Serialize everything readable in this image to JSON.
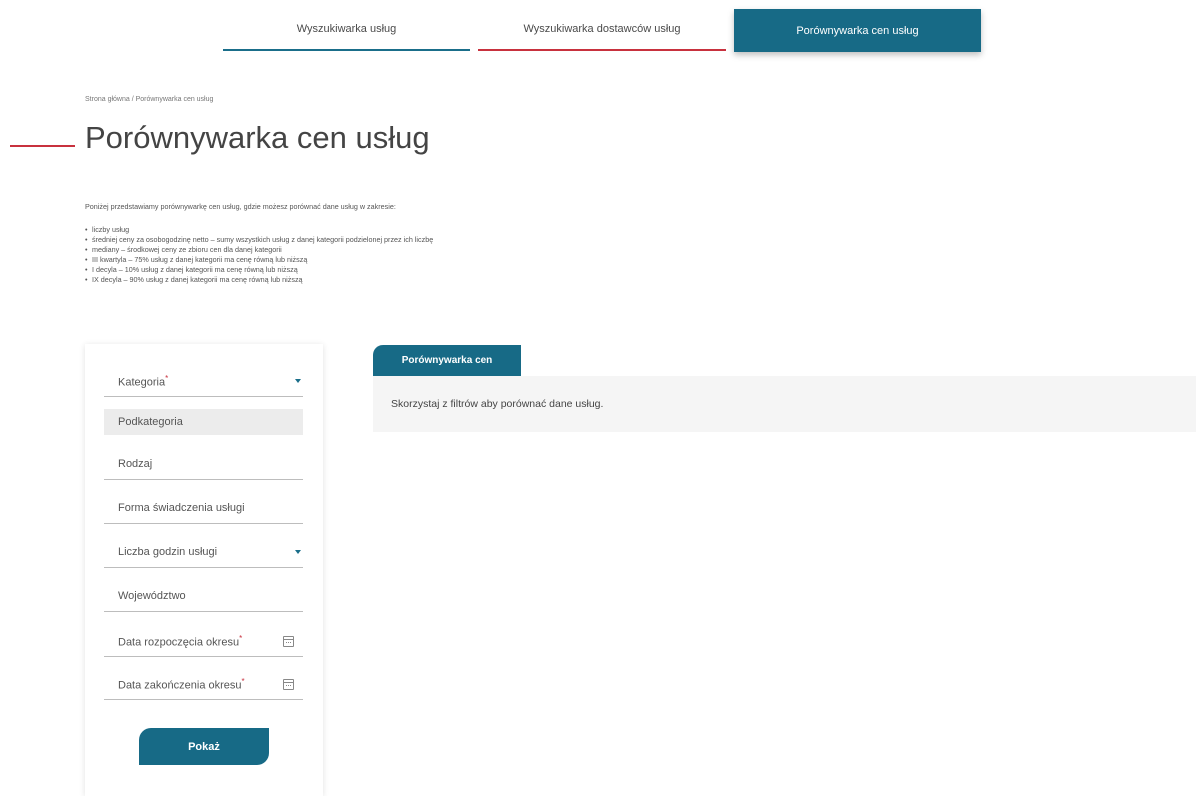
{
  "nav": {
    "tabs": [
      {
        "label": "Wyszukiwarka usług"
      },
      {
        "label": "Wyszukiwarka dostawców usług"
      },
      {
        "label": "Porównywarka cen usług"
      }
    ]
  },
  "breadcrumb": "Strona główna / Porównywarka cen usług",
  "title": "Porównywarka cen usług",
  "intro": {
    "lead": "Poniżej przedstawiamy porównywarkę cen usług, gdzie możesz porównać dane usług w zakresie:",
    "items": [
      "liczby usług",
      "średniej ceny za osobogodzinę netto – sumy wszystkich usług z danej kategorii podzielonej przez ich liczbę",
      "mediany – środkowej ceny ze zbioru cen dla danej kategorii",
      "III kwartyla – 75% usług z danej kategorii ma cenę równą lub niższą",
      "I decyla – 10% usług z danej kategorii ma cenę równą lub niższą",
      "IX decyla – 90% usług z danej kategorii ma cenę równą lub niższą"
    ]
  },
  "filters": {
    "category": {
      "label": "Kategoria",
      "required": "*"
    },
    "subcategory": {
      "label": "Podkategoria"
    },
    "type": {
      "label": "Rodzaj"
    },
    "form": {
      "label": "Forma świadczenia usługi"
    },
    "hours": {
      "label": "Liczba godzin usługi"
    },
    "voivodeship": {
      "label": "Województwo"
    },
    "start_date": {
      "label": "Data rozpoczęcia okresu",
      "required": "*"
    },
    "end_date": {
      "label": "Data zakończenia okresu",
      "required": "*"
    },
    "show_button": "Pokaż"
  },
  "results": {
    "tab_label": "Porównywarka cen",
    "message": "Skorzystaj z filtrów aby porównać dane usług."
  },
  "colors": {
    "accent": "#176a86",
    "red": "#c8313e"
  }
}
